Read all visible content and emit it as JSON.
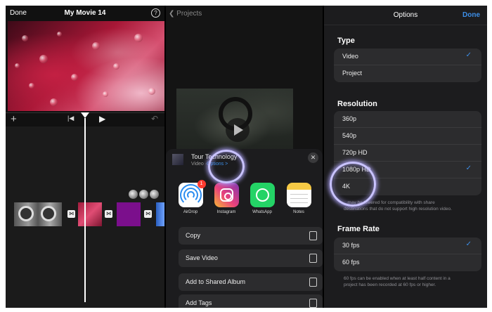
{
  "editor": {
    "done_label": "Done",
    "title": "My Movie 14",
    "help_label": "?"
  },
  "export": {
    "back_label": "Projects",
    "project_title": "Tour Technology",
    "project_sub": "Video ·",
    "options_link": "Options >",
    "close_label": "✕",
    "apps": [
      {
        "label": "AirDrop",
        "icon": "airdrop-icon",
        "badge": "1"
      },
      {
        "label": "Instagram",
        "icon": "instagram-icon"
      },
      {
        "label": "WhatsApp",
        "icon": "whatsapp-icon"
      },
      {
        "label": "Notes",
        "icon": "notes-icon"
      }
    ],
    "actions": [
      {
        "label": "Copy",
        "icon": "copy-icon"
      },
      {
        "label": "Save Video",
        "icon": "save-icon"
      },
      {
        "label": "Add to Shared Album",
        "icon": "shared-album-icon"
      },
      {
        "label": "Add Tags",
        "icon": "tag-icon"
      }
    ]
  },
  "options": {
    "title": "Options",
    "done_label": "Done",
    "type": {
      "heading": "Type",
      "items": [
        {
          "label": "Video",
          "selected": true
        },
        {
          "label": "Project",
          "selected": false
        }
      ]
    },
    "resolution": {
      "heading": "Resolution",
      "items": [
        {
          "label": "360p",
          "selected": false
        },
        {
          "label": "540p",
          "selected": false
        },
        {
          "label": "720p HD",
          "selected": false
        },
        {
          "label": "1080p HD",
          "selected": true
        },
        {
          "label": "4K",
          "selected": false
        }
      ],
      "note_line1": "...may be lowered for compatibility with share",
      "note_line2": "destinations that do not support high resolution video."
    },
    "frame_rate": {
      "heading": "Frame Rate",
      "items": [
        {
          "label": "30 fps",
          "selected": true
        },
        {
          "label": "60 fps",
          "selected": false
        }
      ],
      "note_line1": "60 fps can be enabled when at least half content in a",
      "note_line2": "project has been recorded at 60 fps or higher."
    }
  },
  "colors": {
    "accent": "#3d8fe8",
    "highlight": "#c9c3ff"
  }
}
